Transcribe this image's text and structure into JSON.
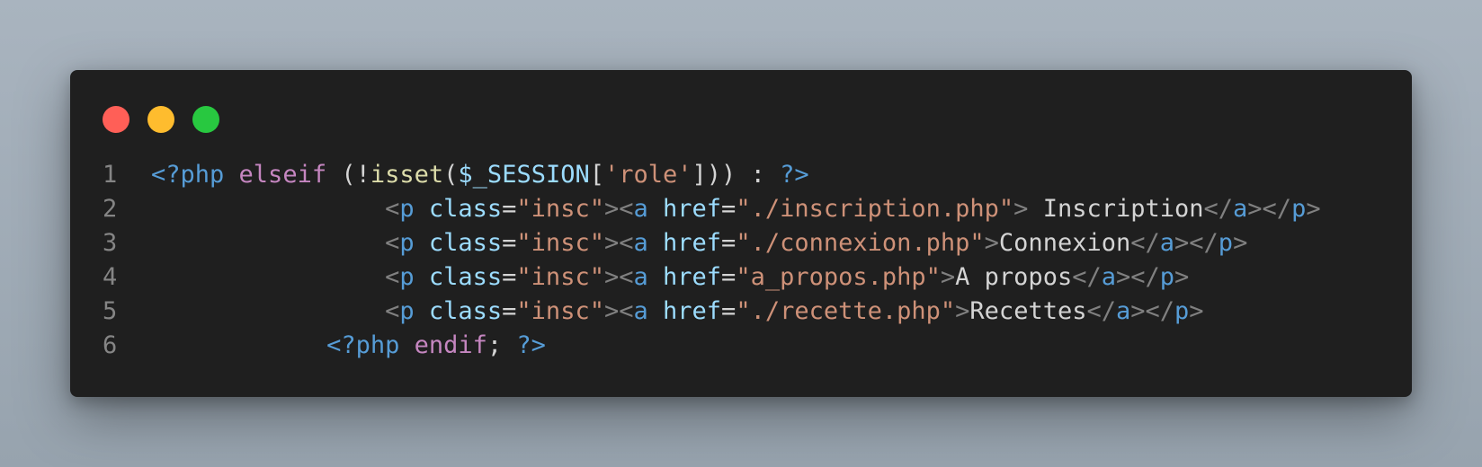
{
  "window": {
    "controls": {
      "close_color": "#ff5f57",
      "minimize_color": "#febc2e",
      "maximize_color": "#28c840"
    }
  },
  "code": {
    "lines": [
      {
        "number": "1",
        "tokens": [
          {
            "text": "<?php",
            "color": "#569cd6"
          },
          {
            "text": " ",
            "color": "#d4d4d4"
          },
          {
            "text": "elseif",
            "color": "#c586c0"
          },
          {
            "text": " (!",
            "color": "#d4d4d4"
          },
          {
            "text": "isset",
            "color": "#dcdcaa"
          },
          {
            "text": "(",
            "color": "#d4d4d4"
          },
          {
            "text": "$_SESSION",
            "color": "#9cdcfe"
          },
          {
            "text": "[",
            "color": "#d4d4d4"
          },
          {
            "text": "'role'",
            "color": "#ce9178"
          },
          {
            "text": "])) : ",
            "color": "#d4d4d4"
          },
          {
            "text": "?>",
            "color": "#569cd6"
          }
        ]
      },
      {
        "number": "2",
        "tokens": [
          {
            "text": "                <",
            "color": "#808080"
          },
          {
            "text": "p",
            "color": "#569cd6"
          },
          {
            "text": " ",
            "color": "#d4d4d4"
          },
          {
            "text": "class",
            "color": "#9cdcfe"
          },
          {
            "text": "=",
            "color": "#d4d4d4"
          },
          {
            "text": "\"insc\"",
            "color": "#ce9178"
          },
          {
            "text": "><",
            "color": "#808080"
          },
          {
            "text": "a",
            "color": "#569cd6"
          },
          {
            "text": " ",
            "color": "#d4d4d4"
          },
          {
            "text": "href",
            "color": "#9cdcfe"
          },
          {
            "text": "=",
            "color": "#d4d4d4"
          },
          {
            "text": "\"./inscription.php\"",
            "color": "#ce9178"
          },
          {
            "text": ">",
            "color": "#808080"
          },
          {
            "text": " Inscription",
            "color": "#d4d4d4"
          },
          {
            "text": "</",
            "color": "#808080"
          },
          {
            "text": "a",
            "color": "#569cd6"
          },
          {
            "text": "></",
            "color": "#808080"
          },
          {
            "text": "p",
            "color": "#569cd6"
          },
          {
            "text": ">",
            "color": "#808080"
          }
        ]
      },
      {
        "number": "3",
        "tokens": [
          {
            "text": "                <",
            "color": "#808080"
          },
          {
            "text": "p",
            "color": "#569cd6"
          },
          {
            "text": " ",
            "color": "#d4d4d4"
          },
          {
            "text": "class",
            "color": "#9cdcfe"
          },
          {
            "text": "=",
            "color": "#d4d4d4"
          },
          {
            "text": "\"insc\"",
            "color": "#ce9178"
          },
          {
            "text": "><",
            "color": "#808080"
          },
          {
            "text": "a",
            "color": "#569cd6"
          },
          {
            "text": " ",
            "color": "#d4d4d4"
          },
          {
            "text": "href",
            "color": "#9cdcfe"
          },
          {
            "text": "=",
            "color": "#d4d4d4"
          },
          {
            "text": "\"./connexion.php\"",
            "color": "#ce9178"
          },
          {
            "text": ">",
            "color": "#808080"
          },
          {
            "text": "Connexion",
            "color": "#d4d4d4"
          },
          {
            "text": "</",
            "color": "#808080"
          },
          {
            "text": "a",
            "color": "#569cd6"
          },
          {
            "text": "></",
            "color": "#808080"
          },
          {
            "text": "p",
            "color": "#569cd6"
          },
          {
            "text": ">",
            "color": "#808080"
          }
        ]
      },
      {
        "number": "4",
        "tokens": [
          {
            "text": "                <",
            "color": "#808080"
          },
          {
            "text": "p",
            "color": "#569cd6"
          },
          {
            "text": " ",
            "color": "#d4d4d4"
          },
          {
            "text": "class",
            "color": "#9cdcfe"
          },
          {
            "text": "=",
            "color": "#d4d4d4"
          },
          {
            "text": "\"insc\"",
            "color": "#ce9178"
          },
          {
            "text": "><",
            "color": "#808080"
          },
          {
            "text": "a",
            "color": "#569cd6"
          },
          {
            "text": " ",
            "color": "#d4d4d4"
          },
          {
            "text": "href",
            "color": "#9cdcfe"
          },
          {
            "text": "=",
            "color": "#d4d4d4"
          },
          {
            "text": "\"a_propos.php\"",
            "color": "#ce9178"
          },
          {
            "text": ">",
            "color": "#808080"
          },
          {
            "text": "A propos",
            "color": "#d4d4d4"
          },
          {
            "text": "</",
            "color": "#808080"
          },
          {
            "text": "a",
            "color": "#569cd6"
          },
          {
            "text": "></",
            "color": "#808080"
          },
          {
            "text": "p",
            "color": "#569cd6"
          },
          {
            "text": ">",
            "color": "#808080"
          }
        ]
      },
      {
        "number": "5",
        "tokens": [
          {
            "text": "                <",
            "color": "#808080"
          },
          {
            "text": "p",
            "color": "#569cd6"
          },
          {
            "text": " ",
            "color": "#d4d4d4"
          },
          {
            "text": "class",
            "color": "#9cdcfe"
          },
          {
            "text": "=",
            "color": "#d4d4d4"
          },
          {
            "text": "\"insc\"",
            "color": "#ce9178"
          },
          {
            "text": "><",
            "color": "#808080"
          },
          {
            "text": "a",
            "color": "#569cd6"
          },
          {
            "text": " ",
            "color": "#d4d4d4"
          },
          {
            "text": "href",
            "color": "#9cdcfe"
          },
          {
            "text": "=",
            "color": "#d4d4d4"
          },
          {
            "text": "\"./recette.php\"",
            "color": "#ce9178"
          },
          {
            "text": ">",
            "color": "#808080"
          },
          {
            "text": "Recettes",
            "color": "#d4d4d4"
          },
          {
            "text": "</",
            "color": "#808080"
          },
          {
            "text": "a",
            "color": "#569cd6"
          },
          {
            "text": "></",
            "color": "#808080"
          },
          {
            "text": "p",
            "color": "#569cd6"
          },
          {
            "text": ">",
            "color": "#808080"
          }
        ]
      },
      {
        "number": "6",
        "tokens": [
          {
            "text": "            ",
            "color": "#d4d4d4"
          },
          {
            "text": "<?php",
            "color": "#569cd6"
          },
          {
            "text": " ",
            "color": "#d4d4d4"
          },
          {
            "text": "endif",
            "color": "#c586c0"
          },
          {
            "text": "; ",
            "color": "#d4d4d4"
          },
          {
            "text": "?>",
            "color": "#569cd6"
          }
        ]
      }
    ]
  }
}
